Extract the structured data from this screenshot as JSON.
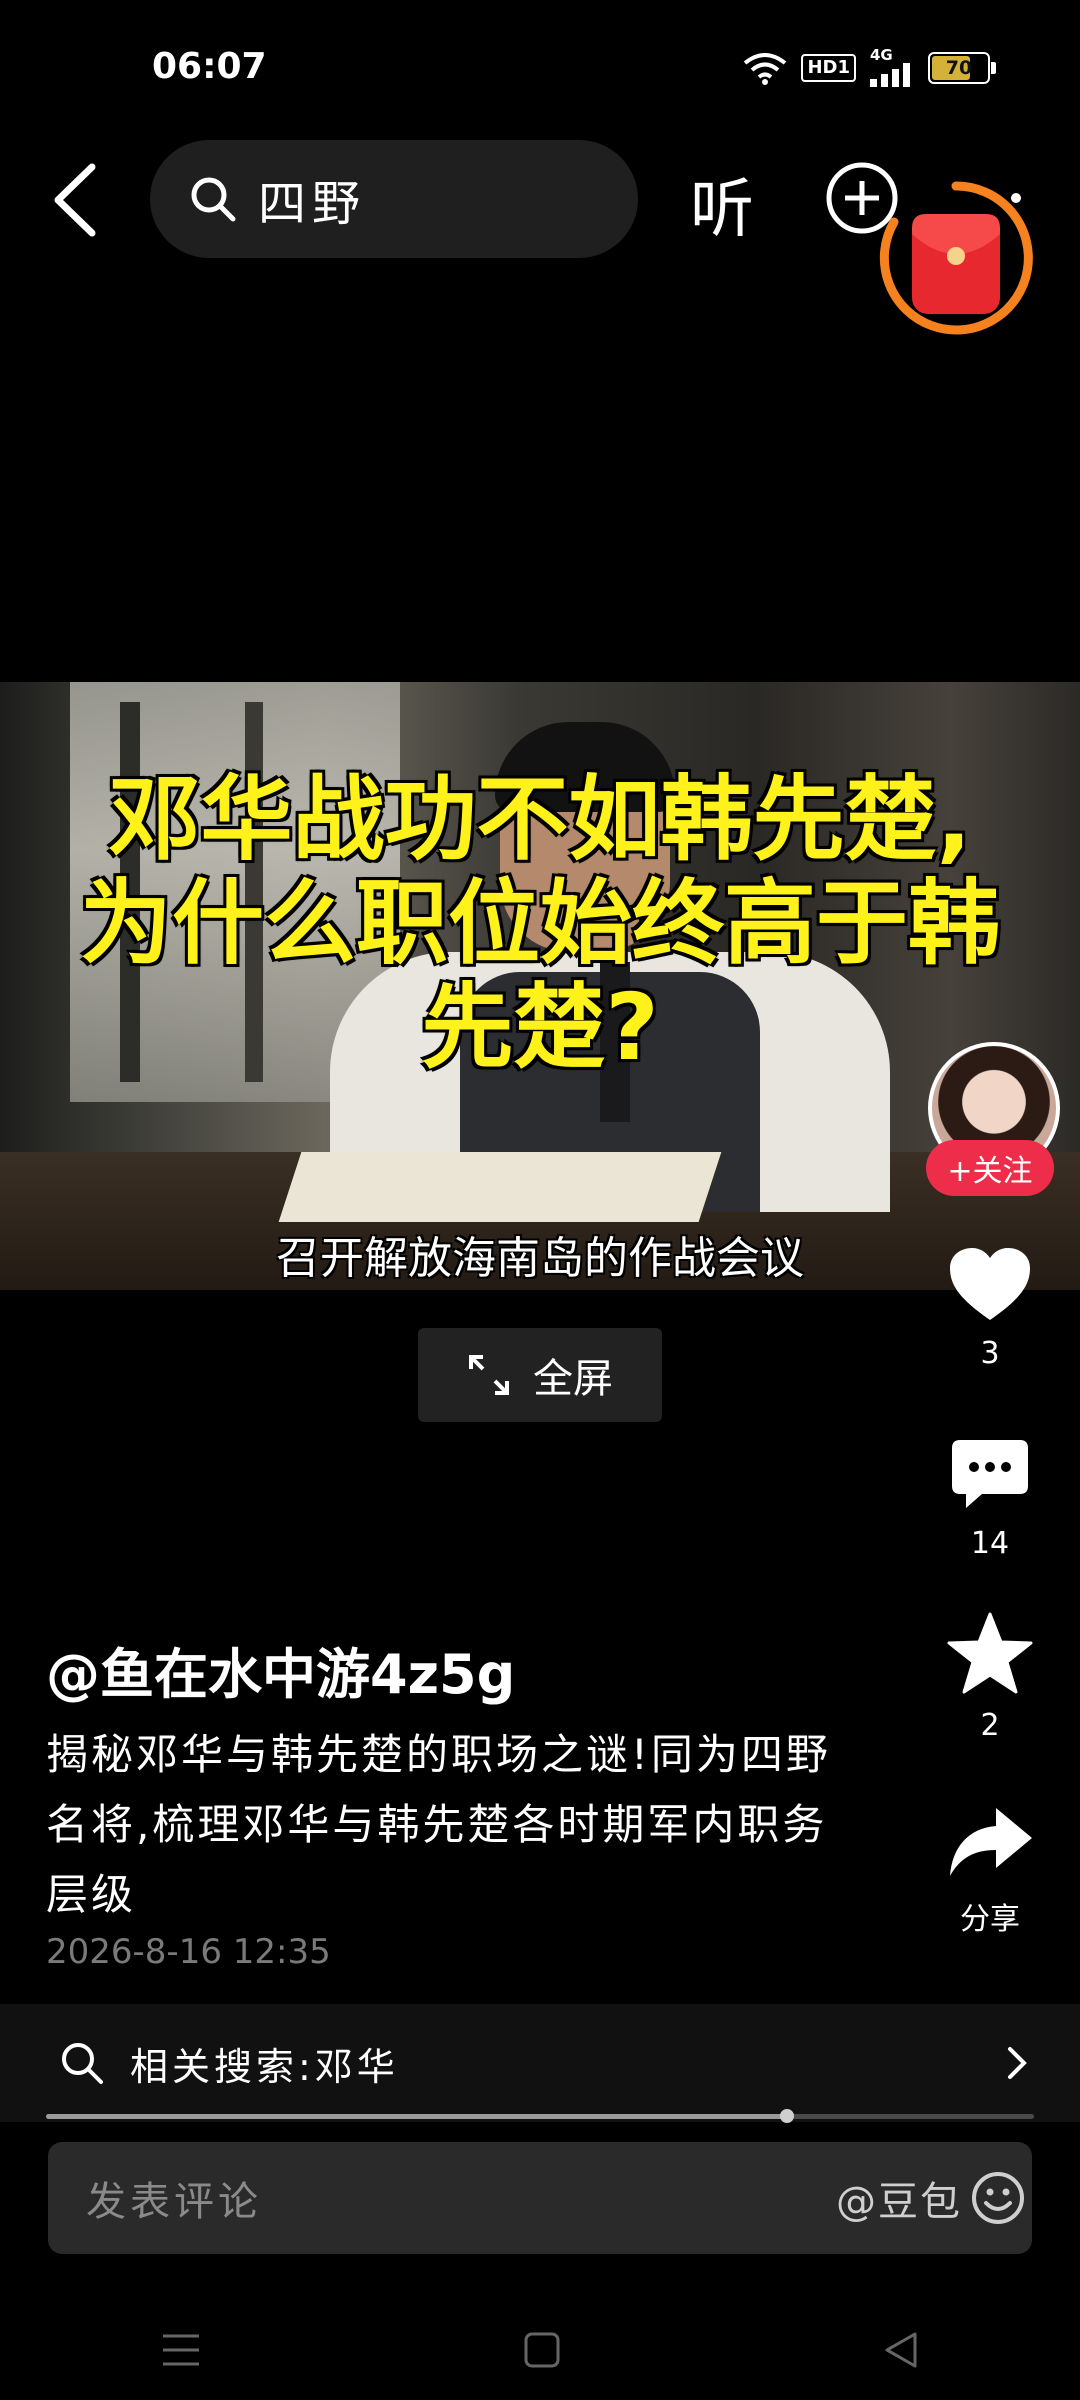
{
  "status_bar": {
    "time": "06:07",
    "network": "4G",
    "hd_label": "HD1",
    "battery": "70",
    "battery_level": 0.7
  },
  "top_bar": {
    "search_query": "四野",
    "listen_label": "听"
  },
  "video": {
    "overlay_title": [
      "邓华战功不如韩先楚,",
      "为什么职位始终高于韩",
      "先楚?"
    ],
    "subtitle": "召开解放海南岛的作战会议",
    "fullscreen_label": "全屏"
  },
  "right_rail": {
    "follow_label": "+关注",
    "likes": "3",
    "comments": "14",
    "favorites": "2",
    "share_label": "分享"
  },
  "post": {
    "author": "@鱼在水中游4z5g",
    "description": "揭秘邓华与韩先楚的职场之谜!同为四野名将,梳理邓华与韩先楚各时期军内职务层级",
    "date": "2026-8-16 12:35"
  },
  "related_search": {
    "label": "相关搜索:邓华"
  },
  "playback": {
    "progress": 0.75
  },
  "comment_bar": {
    "placeholder": "发表评论",
    "mention": "@豆包"
  },
  "colors": {
    "accent_red": "#ee2d4a",
    "title_yellow": "#fff21a",
    "redpacket_orange": "#f5821f"
  }
}
